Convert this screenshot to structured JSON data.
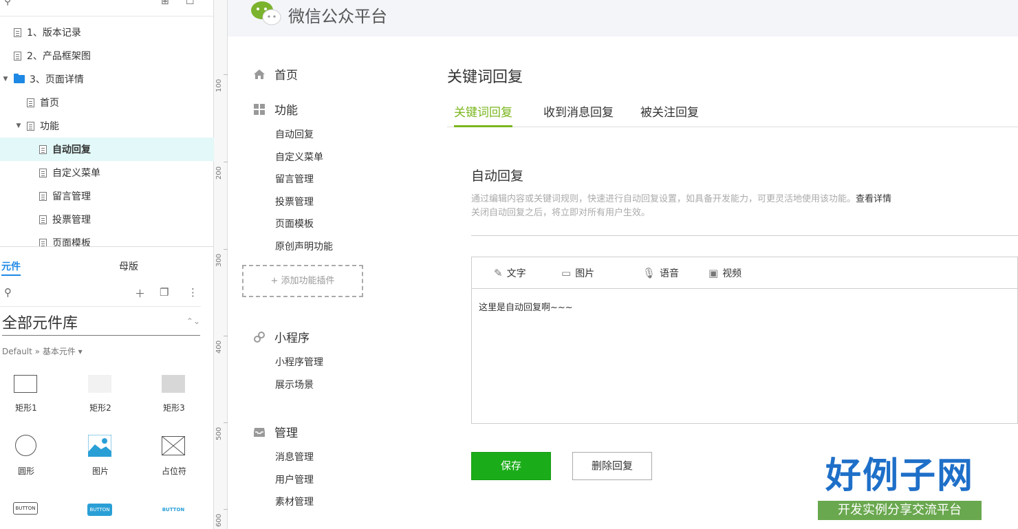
{
  "page_tree": {
    "items": [
      {
        "label": "1、版本记录",
        "type": "page"
      },
      {
        "label": "2、产品框架图",
        "type": "page"
      },
      {
        "label": "3、页面详情",
        "type": "folder",
        "expanded": true
      },
      {
        "label": "首页",
        "type": "page"
      },
      {
        "label": "功能",
        "type": "page",
        "expanded": true
      },
      {
        "label": "自动回复",
        "type": "page",
        "selected": true
      },
      {
        "label": "自定义菜单",
        "type": "page"
      },
      {
        "label": "留言管理",
        "type": "page"
      },
      {
        "label": "投票管理",
        "type": "page"
      },
      {
        "label": "页面模板",
        "type": "page"
      }
    ]
  },
  "library": {
    "tabs": [
      "元件",
      "母版"
    ],
    "active_tab": "元件",
    "selected_library": "全部元件库",
    "breadcrumb": "Default » 基本元件 ▾",
    "widgets": [
      {
        "label": "矩形1",
        "icon": "rectangle-outline"
      },
      {
        "label": "矩形2",
        "icon": "rectangle-light-gray"
      },
      {
        "label": "矩形3",
        "icon": "rectangle-gray"
      },
      {
        "label": "圆形",
        "icon": "circle-outline"
      },
      {
        "label": "图片",
        "icon": "image-icon"
      },
      {
        "label": "占位符",
        "icon": "placeholder-icon"
      },
      {
        "label": "BUTTON",
        "icon": "button-outline"
      },
      {
        "label": "BUTTON",
        "icon": "button-primary"
      },
      {
        "label": "BUTTON",
        "icon": "button-link"
      }
    ]
  },
  "ruler": {
    "marks": [
      "100",
      "200",
      "300",
      "400",
      "500",
      "600"
    ]
  },
  "wechat": {
    "platform_title": "微信公众平台",
    "sidebar": {
      "home": "首页",
      "function_group": "功能",
      "function_items": [
        "自动回复",
        "自定义菜单",
        "留言管理",
        "投票管理",
        "页面模板",
        "原创声明功能"
      ],
      "add_plugin": "+ 添加功能插件",
      "miniapp_group": "小程序",
      "miniapp_items": [
        "小程序管理",
        "展示场景"
      ],
      "manage_group": "管理",
      "manage_items": [
        "消息管理",
        "用户管理",
        "素材管理"
      ]
    },
    "main": {
      "title": "关键词回复",
      "tabs": [
        "关键词回复",
        "收到消息回复",
        "被关注回复"
      ],
      "active_tab": "关键词回复",
      "card_title": "自动回复",
      "desc_line1": "通过编辑内容或关键词规则，快速进行自动回复设置，如具备开发能力，可更灵活地使用该功能。",
      "desc_link": "查看详情",
      "desc_line2": "关闭自动回复之后，将立即对所有用户生效。",
      "media_types": [
        "文字",
        "图片",
        "语音",
        "视频"
      ],
      "reply_text": "这里是自动回复啊~~~",
      "save_label": "保存",
      "delete_label": "删除回复"
    }
  },
  "stamp": {
    "big": "好例子网",
    "small": "开发实例分享交流平台"
  },
  "colors": {
    "accent_green": "#7ab61d",
    "save_green": "#1aad19",
    "axure_blue": "#1e88e5",
    "selected_row": "#e3f8f8"
  }
}
